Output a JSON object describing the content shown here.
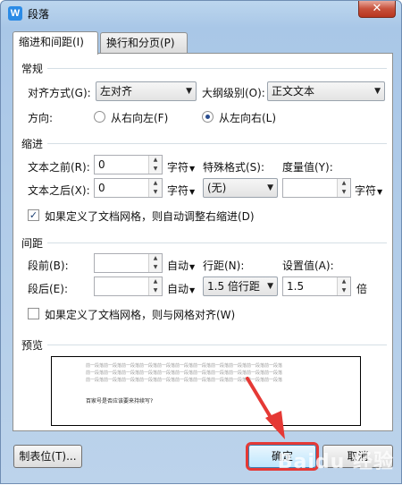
{
  "window": {
    "title": "段落",
    "app_icon_letter": "W",
    "close_glyph": "✕"
  },
  "tabs": [
    {
      "label": "缩进和间距(I)",
      "active": true
    },
    {
      "label": "换行和分页(P)",
      "active": false
    }
  ],
  "general": {
    "section_title": "常规",
    "alignment": {
      "label": "对齐方式(G):",
      "value": "左对齐"
    },
    "outline_level": {
      "label": "大纲级别(O):",
      "value": "正文文本"
    },
    "direction": {
      "label": "方向:",
      "rtl_label": "从右向左(F)",
      "ltr_label": "从左向右(L)",
      "selected": "ltr"
    }
  },
  "indent": {
    "section_title": "缩进",
    "before_text": {
      "label": "文本之前(R):",
      "value": "0",
      "unit": "字符"
    },
    "after_text": {
      "label": "文本之后(X):",
      "value": "0",
      "unit": "字符"
    },
    "special": {
      "label": "特殊格式(S):",
      "value": "(无)"
    },
    "by": {
      "label": "度量值(Y):",
      "value": "",
      "unit": "字符"
    },
    "auto_adjust": {
      "label": "如果定义了文档网格，则自动调整右缩进(D)",
      "checked": true
    }
  },
  "spacing": {
    "section_title": "间距",
    "before": {
      "label": "段前(B):",
      "value": "",
      "unit": "自动"
    },
    "after": {
      "label": "段后(E):",
      "value": "",
      "unit": "自动"
    },
    "line_spacing": {
      "label": "行距(N):",
      "value": "1.5 倍行距"
    },
    "at": {
      "label": "设置值(A):",
      "value": "1.5",
      "unit": "倍"
    },
    "snap_grid": {
      "label": "如果定义了文档网格，则与网格对齐(W)",
      "checked": false
    }
  },
  "preview": {
    "section_title": "预览",
    "prev_line_text": "前一段落前一段落前一段落前一段落前一段落前一段落前一段落前一段落前一段落前一段落前一段落",
    "sample_text": "百家号是否应该要来持续写?"
  },
  "buttons": {
    "tabs_label": "制表位(T)...",
    "ok_label": "确定",
    "cancel_label": "取消"
  },
  "watermark": "Baidu 经验",
  "colors": {
    "annotation_red": "#e53935",
    "titlebar": "#bcd6ee"
  }
}
